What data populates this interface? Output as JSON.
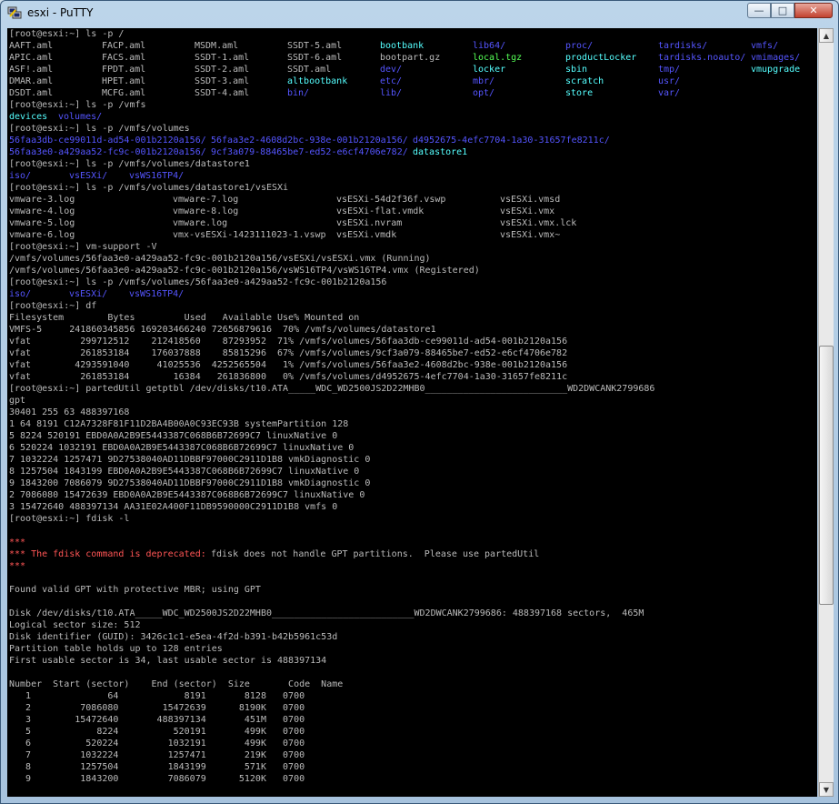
{
  "window": {
    "title": "esxi - PuTTY",
    "buttons": {
      "minimize": "—",
      "maximize": "□",
      "close": "✕"
    },
    "scroll_position": 0.63,
    "scroll_visible_fraction": 0.35
  },
  "colors": {
    "default": "#bbbbbb",
    "blue": "#5555ff",
    "cyan": "#55ffff",
    "green": "#55ff55",
    "red": "#ff5555"
  },
  "terminal": {
    "lines": [
      [
        [
          "[root@esxi:~] ls -p /",
          "d",
          0
        ]
      ],
      [
        [
          "AAFT.aml",
          "d",
          0
        ],
        [
          "FACP.aml",
          "d",
          102
        ],
        [
          "MSDM.aml",
          "d",
          204
        ],
        [
          "SSDT-5.aml",
          "d",
          306
        ],
        [
          "bootbank",
          "c",
          408
        ],
        [
          "lib64/",
          "b",
          510
        ],
        [
          "proc/",
          "b",
          612
        ],
        [
          "tardisks/",
          "b",
          714
        ],
        [
          "vmfs/",
          "b",
          816
        ]
      ],
      [
        [
          "APIC.aml",
          "d",
          0
        ],
        [
          "FACS.aml",
          "d",
          102
        ],
        [
          "SSDT-1.aml",
          "d",
          204
        ],
        [
          "SSDT-6.aml",
          "d",
          306
        ],
        [
          "bootpart.gz",
          "d",
          408
        ],
        [
          "local.tgz",
          "g",
          510
        ],
        [
          "productLocker",
          "c",
          612
        ],
        [
          "tardisks.noauto/",
          "b",
          714
        ],
        [
          "vmimages/",
          "b",
          816
        ]
      ],
      [
        [
          "ASF!.aml",
          "d",
          0
        ],
        [
          "FPDT.aml",
          "d",
          102
        ],
        [
          "SSDT-2.aml",
          "d",
          204
        ],
        [
          "SSDT.aml",
          "d",
          306
        ],
        [
          "dev/",
          "b",
          408
        ],
        [
          "locker",
          "c",
          510
        ],
        [
          "sbin",
          "c",
          612
        ],
        [
          "tmp/",
          "b",
          714
        ],
        [
          "vmupgrade",
          "c",
          816
        ]
      ],
      [
        [
          "DMAR.aml",
          "d",
          0
        ],
        [
          "HPET.aml",
          "d",
          102
        ],
        [
          "SSDT-3.aml",
          "d",
          204
        ],
        [
          "altbootbank",
          "c",
          306
        ],
        [
          "etc/",
          "b",
          408
        ],
        [
          "mbr/",
          "b",
          510
        ],
        [
          "scratch",
          "c",
          612
        ],
        [
          "usr/",
          "b",
          714
        ]
      ],
      [
        [
          "DSDT.aml",
          "d",
          0
        ],
        [
          "MCFG.aml",
          "d",
          102
        ],
        [
          "SSDT-4.aml",
          "d",
          204
        ],
        [
          "bin/",
          "b",
          306
        ],
        [
          "lib/",
          "b",
          408
        ],
        [
          "opt/",
          "b",
          510
        ],
        [
          "store",
          "c",
          612
        ],
        [
          "var/",
          "b",
          714
        ]
      ],
      [
        [
          "[root@esxi:~] ls -p /vmfs",
          "d",
          0
        ]
      ],
      [
        [
          "devices",
          "c",
          0
        ],
        [
          "volumes/",
          "b",
          54
        ]
      ],
      [
        [
          "[root@esxi:~] ls -p /vmfs/volumes",
          "d",
          0
        ]
      ],
      [
        [
          "56faa3db-ce99011d-ad54-001b2120a156/",
          "b",
          0
        ],
        [
          "56faa3e2-4608d2bc-938e-001b2120a156/",
          "b",
          222
        ],
        [
          "d4952675-4efc7704-1a30-31657fe8211c/",
          "b",
          444
        ]
      ],
      [
        [
          "56faa3e0-a429aa52-fc9c-001b2120a156/",
          "b",
          0
        ],
        [
          "9cf3a079-88465be7-ed52-e6cf4706e782/",
          "b",
          222
        ],
        [
          "datastore1",
          "c",
          444
        ]
      ],
      [
        [
          "[root@esxi:~] ls -p /vmfs/volumes/datastore1",
          "d",
          0
        ]
      ],
      [
        [
          "iso/",
          "b",
          0
        ],
        [
          "vsESXi/",
          "b",
          66
        ],
        [
          "vsWS16TP4/",
          "b",
          132
        ]
      ],
      [
        [
          "[root@esxi:~] ls -p /vmfs/volumes/datastore1/vsESXi",
          "d",
          0
        ]
      ],
      [
        [
          "vmware-3.log",
          "d",
          0
        ],
        [
          "vmware-7.log",
          "d",
          180
        ],
        [
          "vsESXi-54d2f36f.vswp",
          "d",
          360
        ],
        [
          "vsESXi.vmsd",
          "d",
          540
        ]
      ],
      [
        [
          "vmware-4.log",
          "d",
          0
        ],
        [
          "vmware-8.log",
          "d",
          180
        ],
        [
          "vsESXi-flat.vmdk",
          "d",
          360
        ],
        [
          "vsESXi.vmx",
          "d",
          540
        ]
      ],
      [
        [
          "vmware-5.log",
          "d",
          0
        ],
        [
          "vmware.log",
          "d",
          180
        ],
        [
          "vsESXi.nvram",
          "d",
          360
        ],
        [
          "vsESXi.vmx.lck",
          "d",
          540
        ]
      ],
      [
        [
          "vmware-6.log",
          "d",
          0
        ],
        [
          "vmx-vsESXi-1423111023-1.vswp",
          "d",
          180
        ],
        [
          "vsESXi.vmdk",
          "d",
          360
        ],
        [
          "vsESXi.vmx~",
          "d",
          540
        ]
      ],
      [
        [
          "[root@esxi:~] vm-support -V",
          "d",
          0
        ]
      ],
      [
        [
          "/vmfs/volumes/56faa3e0-a429aa52-fc9c-001b2120a156/vsESXi/vsESXi.vmx (Running)",
          "d",
          0
        ]
      ],
      [
        [
          "/vmfs/volumes/56faa3e0-a429aa52-fc9c-001b2120a156/vsWS16TP4/vsWS16TP4.vmx (Registered)",
          "d",
          0
        ]
      ],
      [
        [
          "[root@esxi:~] ls -p /vmfs/volumes/56faa3e0-a429aa52-fc9c-001b2120a156",
          "d",
          0
        ]
      ],
      [
        [
          "iso/",
          "b",
          0
        ],
        [
          "vsESXi/",
          "b",
          66
        ],
        [
          "vsWS16TP4/",
          "b",
          132
        ]
      ],
      [
        [
          "[root@esxi:~] df",
          "d",
          0
        ]
      ],
      [
        [
          "Filesystem        Bytes         Used   Available Use% Mounted on",
          "d",
          0
        ]
      ],
      [
        [
          "VMFS-5     241860345856 169203466240 72656879616  70% /vmfs/volumes/datastore1",
          "d",
          0
        ]
      ],
      [
        [
          "vfat         299712512    212418560    87293952  71% /vmfs/volumes/56faa3db-ce99011d-ad54-001b2120a156",
          "d",
          0
        ]
      ],
      [
        [
          "vfat         261853184    176037888    85815296  67% /vmfs/volumes/9cf3a079-88465be7-ed52-e6cf4706e782",
          "d",
          0
        ]
      ],
      [
        [
          "vfat        4293591040     41025536  4252565504   1% /vmfs/volumes/56faa3e2-4608d2bc-938e-001b2120a156",
          "d",
          0
        ]
      ],
      [
        [
          "vfat         261853184        16384   261836800   0% /vmfs/volumes/d4952675-4efc7704-1a30-31657fe8211c",
          "d",
          0
        ]
      ],
      [
        [
          "[root@esxi:~] partedUtil getptbl /dev/disks/t10.ATA_____WDC_WD2500JS2D22MHB0__________________________WD2DWCANK2799686",
          "d",
          0
        ]
      ],
      [
        [
          "gpt",
          "d",
          0
        ]
      ],
      [
        [
          "30401 255 63 488397168",
          "d",
          0
        ]
      ],
      [
        [
          "1 64 8191 C12A7328F81F11D2BA4B00A0C93EC93B systemPartition 128",
          "d",
          0
        ]
      ],
      [
        [
          "5 8224 520191 EBD0A0A2B9E5443387C068B6B72699C7 linuxNative 0",
          "d",
          0
        ]
      ],
      [
        [
          "6 520224 1032191 EBD0A0A2B9E5443387C068B6B72699C7 linuxNative 0",
          "d",
          0
        ]
      ],
      [
        [
          "7 1032224 1257471 9D27538040AD11DBBF97000C2911D1B8 vmkDiagnostic 0",
          "d",
          0
        ]
      ],
      [
        [
          "8 1257504 1843199 EBD0A0A2B9E5443387C068B6B72699C7 linuxNative 0",
          "d",
          0
        ]
      ],
      [
        [
          "9 1843200 7086079 9D27538040AD11DBBF97000C2911D1B8 vmkDiagnostic 0",
          "d",
          0
        ]
      ],
      [
        [
          "2 7086080 15472639 EBD0A0A2B9E5443387C068B6B72699C7 linuxNative 0",
          "d",
          0
        ]
      ],
      [
        [
          "3 15472640 488397134 AA31E02A400F11DB9590000C2911D1B8 vmfs 0",
          "d",
          0
        ]
      ],
      [
        [
          "[root@esxi:~] fdisk -l",
          "d",
          0
        ]
      ],
      [],
      [
        [
          "***",
          "r",
          0
        ]
      ],
      [
        [
          "*** The fdisk command is deprecated:",
          "r",
          0
        ],
        [
          "fdisk does not handle GPT partitions.  Please use partedUtil",
          "d",
          222
        ]
      ],
      [
        [
          "***",
          "r",
          0
        ]
      ],
      [],
      [
        [
          "Found valid GPT with protective MBR; using GPT",
          "d",
          0
        ]
      ],
      [],
      [
        [
          "Disk /dev/disks/t10.ATA_____WDC_WD2500JS2D22MHB0__________________________WD2DWCANK2799686: 488397168 sectors,  465M",
          "d",
          0
        ]
      ],
      [
        [
          "Logical sector size: 512",
          "d",
          0
        ]
      ],
      [
        [
          "Disk identifier (GUID): 3426c1c1-e5ea-4f2d-b391-b42b5961c53d",
          "d",
          0
        ]
      ],
      [
        [
          "Partition table holds up to 128 entries",
          "d",
          0
        ]
      ],
      [
        [
          "First usable sector is 34, last usable sector is 488397134",
          "d",
          0
        ]
      ],
      [],
      [
        [
          "Number  Start (sector)    End (sector)  Size       Code  Name",
          "d",
          0
        ]
      ],
      [
        [
          "   1              64            8191       8128   0700",
          "d",
          0
        ]
      ],
      [
        [
          "   2         7086080        15472639      8190K   0700",
          "d",
          0
        ]
      ],
      [
        [
          "   3        15472640       488397134       451M   0700",
          "d",
          0
        ]
      ],
      [
        [
          "   5            8224          520191       499K   0700",
          "d",
          0
        ]
      ],
      [
        [
          "   6          520224         1032191       499K   0700",
          "d",
          0
        ]
      ],
      [
        [
          "   7         1032224         1257471       219K   0700",
          "d",
          0
        ]
      ],
      [
        [
          "   8         1257504         1843199       571K   0700",
          "d",
          0
        ]
      ],
      [
        [
          "   9         1843200         7086079      5120K   0700",
          "d",
          0
        ]
      ]
    ]
  }
}
